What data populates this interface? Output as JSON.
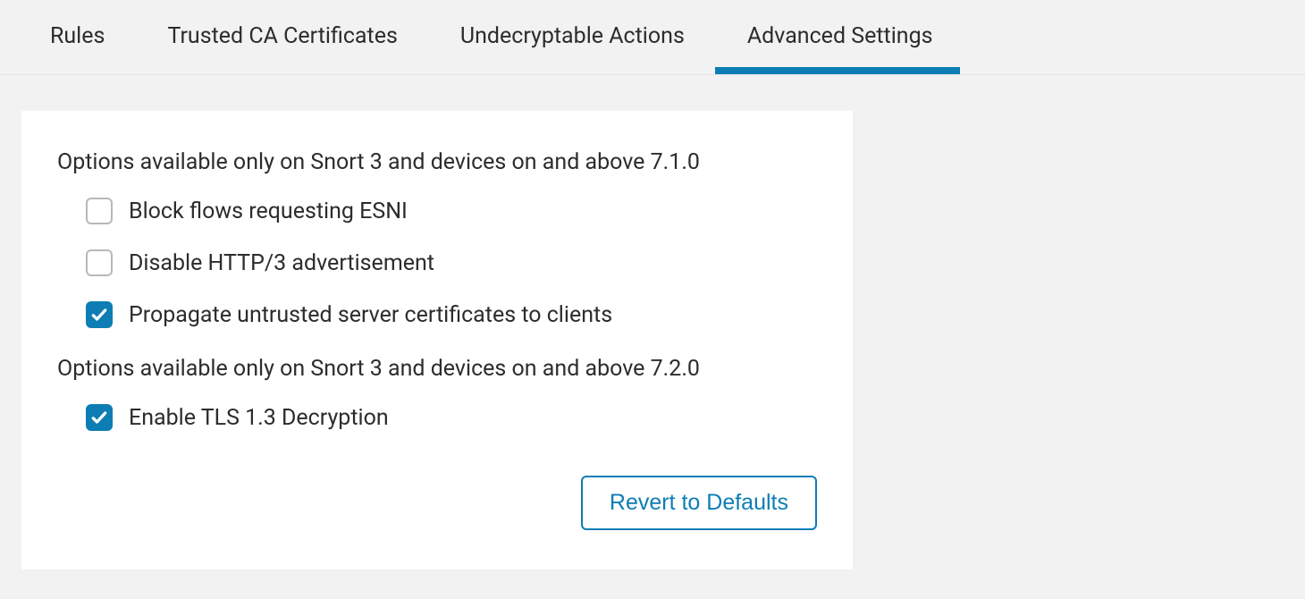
{
  "tabs": [
    {
      "label": "Rules",
      "active": false
    },
    {
      "label": "Trusted CA Certificates",
      "active": false
    },
    {
      "label": "Undecryptable Actions",
      "active": false
    },
    {
      "label": "Advanced Settings",
      "active": true
    }
  ],
  "sections": [
    {
      "header": "Options available only on Snort 3 and devices on and above 7.1.0",
      "options": [
        {
          "label": "Block flows requesting ESNI",
          "checked": false
        },
        {
          "label": "Disable HTTP/3 advertisement",
          "checked": false
        },
        {
          "label": "Propagate untrusted server certificates to clients",
          "checked": true
        }
      ]
    },
    {
      "header": "Options available only on Snort 3 and devices on and above 7.2.0",
      "options": [
        {
          "label": "Enable TLS 1.3 Decryption",
          "checked": true
        }
      ]
    }
  ],
  "revert_button": "Revert to Defaults"
}
